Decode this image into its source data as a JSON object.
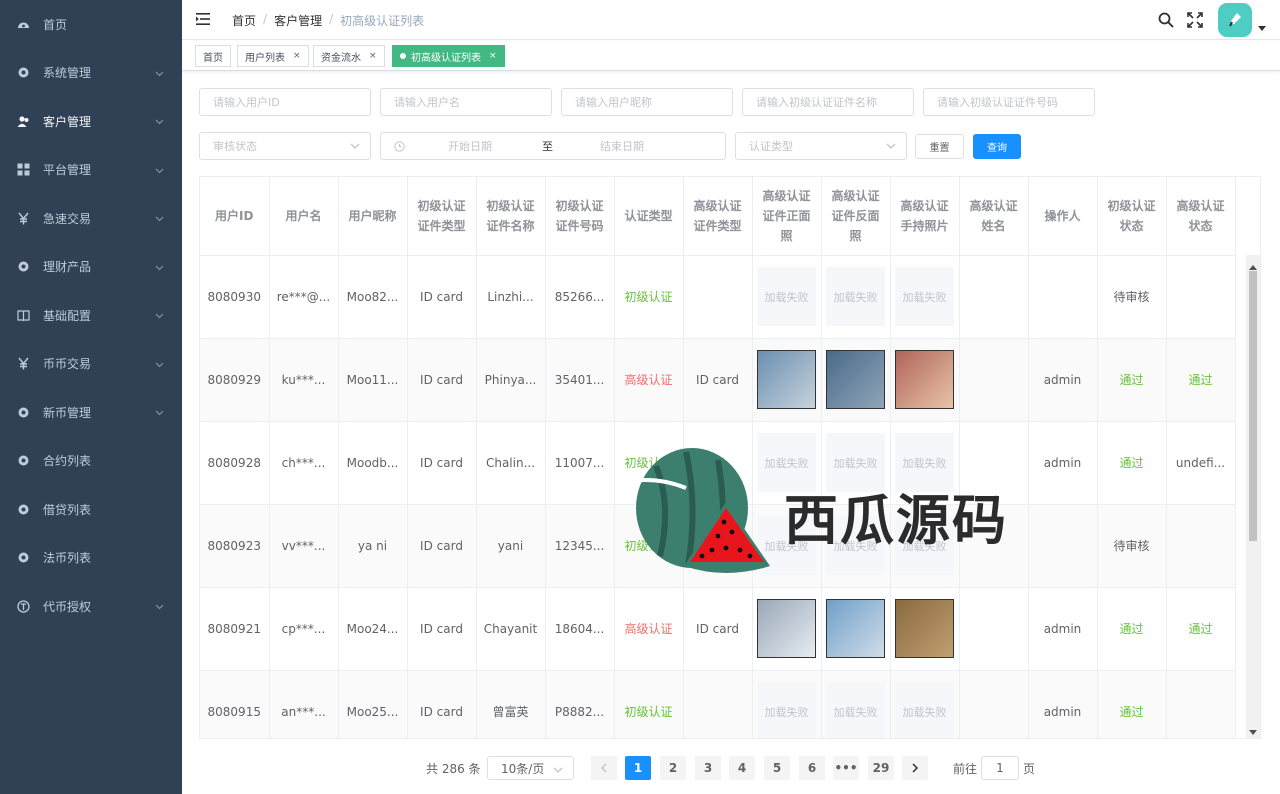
{
  "sidebar": {
    "items": [
      {
        "label": "首页",
        "icon": "dashboard-icon",
        "expandable": false
      },
      {
        "label": "系统管理",
        "icon": "gear-icon",
        "expandable": true
      },
      {
        "label": "客户管理",
        "icon": "users-icon",
        "expandable": true,
        "active": true
      },
      {
        "label": "平台管理",
        "icon": "grid-icon",
        "expandable": true
      },
      {
        "label": "急速交易",
        "icon": "yen-icon",
        "expandable": true
      },
      {
        "label": "理财产品",
        "icon": "gear-icon",
        "expandable": true
      },
      {
        "label": "基础配置",
        "icon": "book-icon",
        "expandable": true
      },
      {
        "label": "币币交易",
        "icon": "yen-icon",
        "expandable": true
      },
      {
        "label": "新币管理",
        "icon": "gear-icon",
        "expandable": true
      },
      {
        "label": "合约列表",
        "icon": "gear-icon",
        "expandable": false
      },
      {
        "label": "借贷列表",
        "icon": "gear-icon",
        "expandable": false
      },
      {
        "label": "法币列表",
        "icon": "gear-icon",
        "expandable": false
      },
      {
        "label": "代币授权",
        "icon": "coin-icon",
        "expandable": true
      }
    ]
  },
  "breadcrumb": [
    "首页",
    "客户管理",
    "初高级认证列表"
  ],
  "tags": [
    {
      "label": "首页",
      "closable": false
    },
    {
      "label": "用户列表",
      "closable": true
    },
    {
      "label": "资金流水",
      "closable": true
    },
    {
      "label": "初高级认证列表",
      "closable": true,
      "active": true
    }
  ],
  "filters": {
    "user_id": "请输入用户ID",
    "username": "请输入用户名",
    "nickname": "请输入用户昵称",
    "primary_cert_name": "请输入初级认证证件名称",
    "primary_cert_no": "请输入初级认证证件号码",
    "review_status": "审核状态",
    "start_date": "开始日期",
    "date_sep": "至",
    "end_date": "结束日期",
    "cert_type": "认证类型",
    "reset": "重置",
    "search": "查询"
  },
  "table": {
    "headers": [
      "用户ID",
      "用户名",
      "用户昵称",
      "初级认证证件类型",
      "初级认证证件名称",
      "初级认证证件号码",
      "认证类型",
      "高级认证证件类型",
      "高级认证证件正面照",
      "高级认证证件反面照",
      "高级认证手持照片",
      "高级认证姓名",
      "操作人",
      "初级认证状态",
      "高级认证状态"
    ],
    "rows": [
      {
        "id": "8080930",
        "username": "re***@...",
        "nickname": "Moo82...",
        "p_type": "ID card",
        "p_name": "Linzhi...",
        "p_no": "85266...",
        "auth": "初级认证",
        "auth_color": "green",
        "a_type": "",
        "img": "加载失败",
        "photos": false,
        "a_name": "",
        "operator": "",
        "p_status": "待审核",
        "p_color": "plain",
        "a_status": "",
        "a_color": "plain"
      },
      {
        "id": "8080929",
        "username": "ku***...",
        "nickname": "Moo11...",
        "p_type": "ID card",
        "p_name": "Phinya...",
        "p_no": "35401...",
        "auth": "高级认证",
        "auth_color": "red",
        "a_type": "ID card",
        "img": "",
        "photos": true,
        "a_name": "",
        "operator": "admin",
        "p_status": "通过",
        "p_color": "green",
        "a_status": "通过",
        "a_color": "green"
      },
      {
        "id": "8080928",
        "username": "ch***...",
        "nickname": "Moodb...",
        "p_type": "ID card",
        "p_name": "Chalin...",
        "p_no": "11007...",
        "auth": "初级认证",
        "auth_color": "green",
        "a_type": "",
        "img": "加载失败",
        "photos": false,
        "a_name": "",
        "operator": "admin",
        "p_status": "通过",
        "p_color": "green",
        "a_status": "undefi...",
        "a_color": "plain"
      },
      {
        "id": "8080923",
        "username": "vv***...",
        "nickname": "ya ni",
        "p_type": "ID card",
        "p_name": "yani",
        "p_no": "12345...",
        "auth": "初级认证",
        "auth_color": "green",
        "a_type": "",
        "img": "加载失败",
        "photos": false,
        "a_name": "",
        "operator": "",
        "p_status": "待审核",
        "p_color": "plain",
        "a_status": "",
        "a_color": "plain"
      },
      {
        "id": "8080921",
        "username": "cp***...",
        "nickname": "Moo24...",
        "p_type": "ID card",
        "p_name": "Chayanit",
        "p_no": "18604...",
        "auth": "高级认证",
        "auth_color": "red",
        "a_type": "ID card",
        "img": "",
        "photos": true,
        "a_name": "",
        "operator": "admin",
        "p_status": "通过",
        "p_color": "green",
        "a_status": "通过",
        "a_color": "green"
      },
      {
        "id": "8080915",
        "username": "an***...",
        "nickname": "Moo25...",
        "p_type": "ID card",
        "p_name": "曾富英",
        "p_no": "P8882...",
        "auth": "初级认证",
        "auth_color": "green",
        "a_type": "",
        "img": "加载失败",
        "photos": false,
        "a_name": "",
        "operator": "admin",
        "p_status": "通过",
        "p_color": "green",
        "a_status": "",
        "a_color": "plain"
      }
    ]
  },
  "pagination": {
    "total": "共 286 条",
    "page_size": "10条/页",
    "pages": [
      "1",
      "2",
      "3",
      "4",
      "5",
      "6",
      "•••",
      "29"
    ],
    "current": "1",
    "goto_prefix": "前往",
    "goto_value": "1",
    "goto_suffix": "页"
  },
  "watermark": "西瓜源码",
  "colors": {
    "sidebar_bg": "#304156",
    "tag_active": "#42b983",
    "primary": "#1890ff",
    "green": "#67c23a",
    "red": "#f56c6c"
  }
}
